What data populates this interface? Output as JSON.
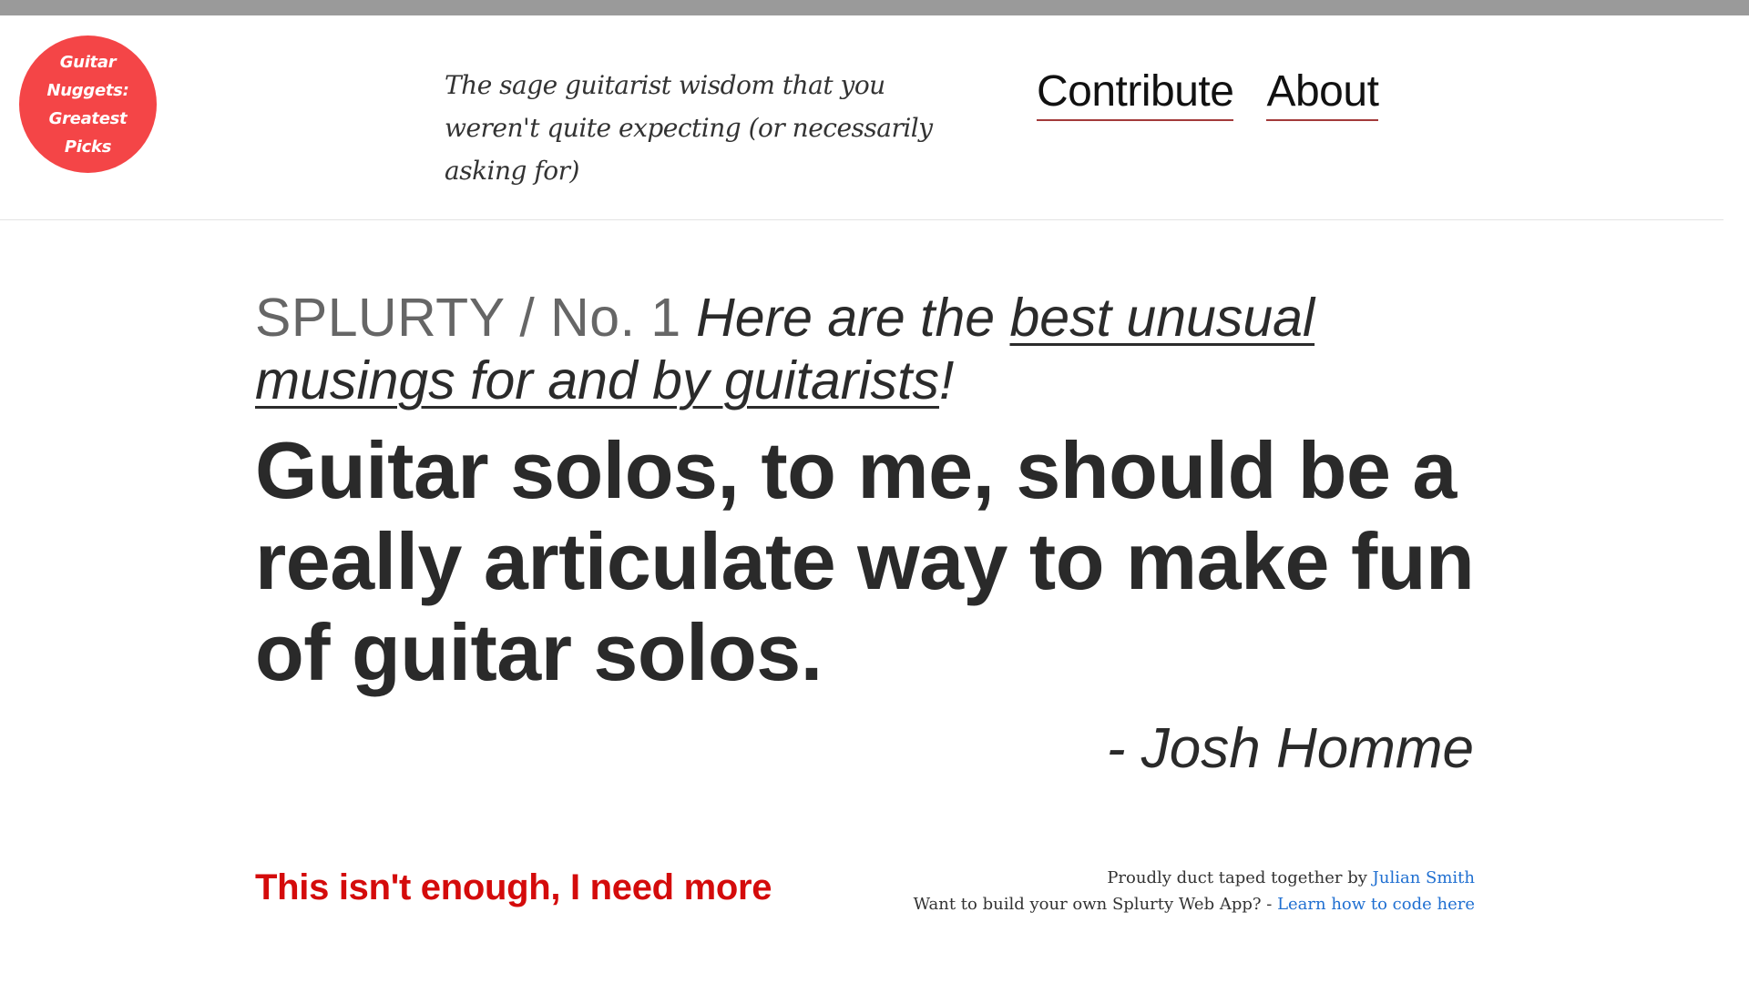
{
  "header": {
    "logo_lines": [
      "Guitar",
      "Nuggets:",
      "Greatest Picks"
    ],
    "tagline": "The sage guitarist wisdom that you weren't quite expecting (or necessarily asking for)",
    "nav": [
      {
        "label": "Contribute"
      },
      {
        "label": "About"
      }
    ]
  },
  "intro": {
    "brand": "SPLURTY / No. 1",
    "text_before": "Here are the",
    "link_text": "best unusual musings for and by guitarists",
    "text_after": "!"
  },
  "quote": {
    "text": "Guitar solos, to me, should be a really articulate way to make fun of guitar solos.",
    "author": "- Josh Homme"
  },
  "footer": {
    "more_link": "This isn't enough, I need more",
    "credit_prefix": "Proudly duct taped together by",
    "credit_name": "Julian Smith",
    "build_prefix": "Want to build your own Splurty Web App? -",
    "build_link": "Learn how to code here"
  },
  "colors": {
    "logo_bg": "#f44547",
    "more_link": "#d40b0b",
    "credit_link": "#1f6fd1",
    "nav_underline": "#a33a3a",
    "topbar": "#9a9a9a"
  }
}
